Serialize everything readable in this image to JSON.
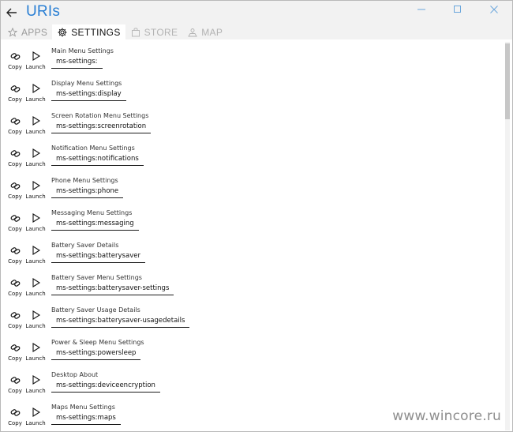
{
  "window": {
    "title": "URIs",
    "controls": [
      "minimize",
      "maximize",
      "close"
    ]
  },
  "tabs": [
    {
      "label": "APPS",
      "icon": "star-icon",
      "state": "inactive"
    },
    {
      "label": "SETTINGS",
      "icon": "gear-icon",
      "state": "active"
    },
    {
      "label": "STORE",
      "icon": "store-icon",
      "state": "disabled"
    },
    {
      "label": "MAP",
      "icon": "map-icon",
      "state": "disabled"
    }
  ],
  "actions": {
    "copy_label": "Copy",
    "launch_label": "Launch"
  },
  "items": [
    {
      "title": "Main Menu Settings",
      "uri": "ms-settings:"
    },
    {
      "title": "Display Menu Settings",
      "uri": "ms-settings:display"
    },
    {
      "title": "Screen Rotation Menu Settings",
      "uri": "ms-settings:screenrotation"
    },
    {
      "title": "Notification Menu Settings",
      "uri": "ms-settings:notifications"
    },
    {
      "title": "Phone Menu Settings",
      "uri": "ms-settings:phone"
    },
    {
      "title": "Messaging Menu Settings",
      "uri": "ms-settings:messaging"
    },
    {
      "title": "Battery Saver Details",
      "uri": "ms-settings:batterysaver"
    },
    {
      "title": "Battery Saver Menu Settings",
      "uri": "ms-settings:batterysaver-settings"
    },
    {
      "title": "Battery Saver Usage Details",
      "uri": "ms-settings:batterysaver-usagedetails"
    },
    {
      "title": "Power & Sleep Menu Settings",
      "uri": "ms-settings:powersleep"
    },
    {
      "title": "Desktop About",
      "uri": "ms-settings:deviceencryption"
    },
    {
      "title": "Maps Menu Settings",
      "uri": "ms-settings:maps"
    }
  ],
  "watermark": "www.wincore.ru",
  "colors": {
    "accent": "#2a7fd4",
    "titlebar": "#f2f2f2"
  }
}
